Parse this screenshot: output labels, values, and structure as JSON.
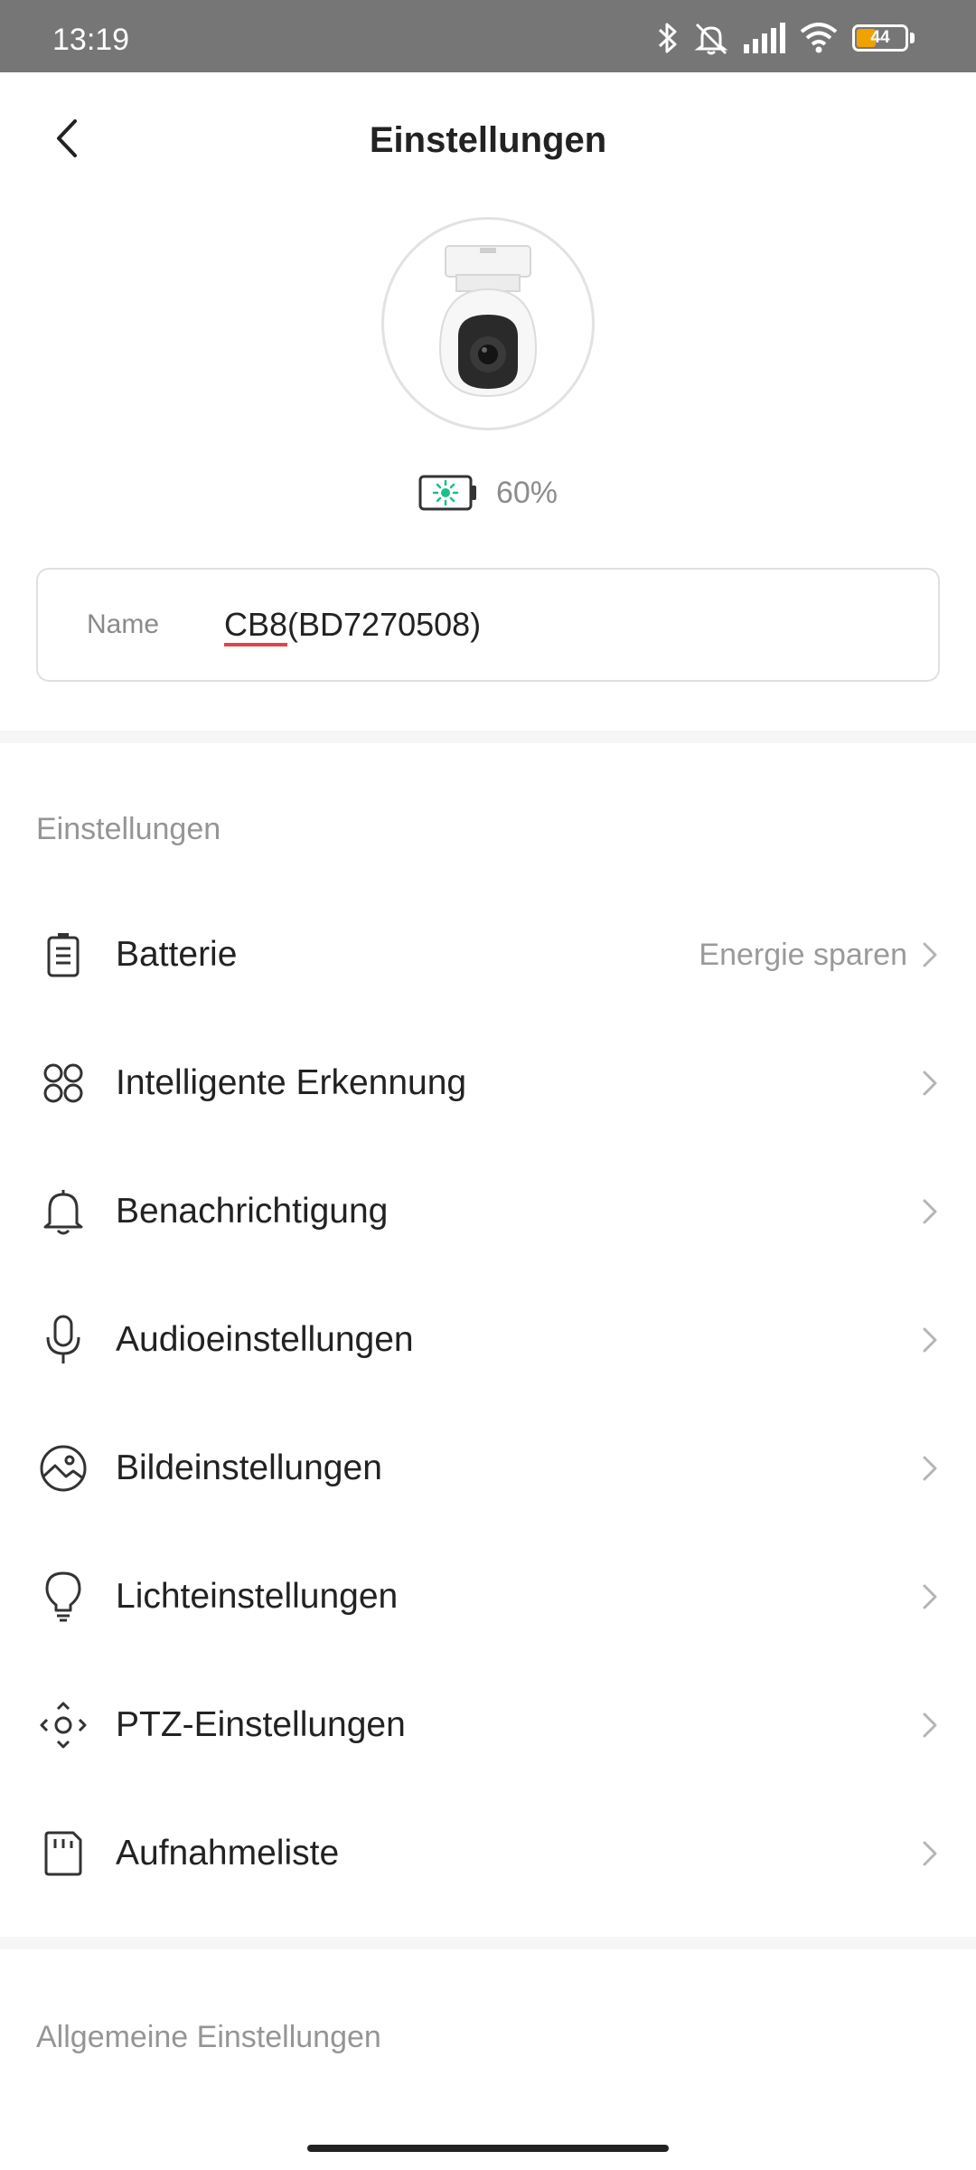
{
  "status_bar": {
    "time": "13:19",
    "battery_level": "44",
    "battery_color": "#f1a100",
    "icons": [
      "bluetooth-icon",
      "mute-icon",
      "signal-icon",
      "wifi-icon",
      "battery-icon"
    ]
  },
  "header": {
    "title": "Einstellungen",
    "back_icon": "chevron-left-icon"
  },
  "device": {
    "image": "camera-image",
    "battery_percent": "60%",
    "battery_icon_color": "#1bbf8a",
    "name_label": "Name",
    "name_value_prefix": "CB8",
    "name_value_suffix": "(BD7270508)"
  },
  "settings_section": {
    "title": "Einstellungen",
    "items": [
      {
        "label": "Batterie",
        "value": "Energie sparen",
        "icon": "battery-icon"
      },
      {
        "label": "Intelligente Erkennung",
        "value": "",
        "icon": "grid-circles-icon"
      },
      {
        "label": "Benachrichtigung",
        "value": "",
        "icon": "bell-icon"
      },
      {
        "label": "Audioeinstellungen",
        "value": "",
        "icon": "microphone-icon"
      },
      {
        "label": "Bildeinstellungen",
        "value": "",
        "icon": "image-icon"
      },
      {
        "label": "Lichteinstellungen",
        "value": "",
        "icon": "lightbulb-icon"
      },
      {
        "label": "PTZ-Einstellungen",
        "value": "",
        "icon": "ptz-icon"
      },
      {
        "label": "Aufnahmeliste",
        "value": "",
        "icon": "sd-card-icon"
      }
    ]
  },
  "general_section": {
    "title": "Allgemeine Einstellungen"
  }
}
